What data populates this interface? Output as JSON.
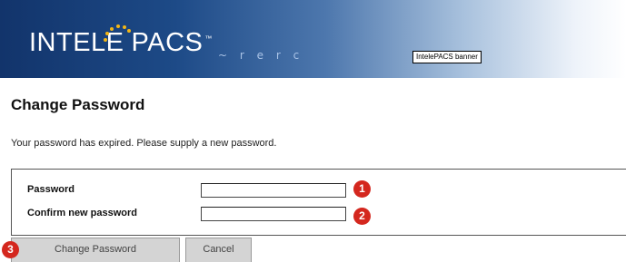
{
  "banner": {
    "logo_left": "INTELE",
    "logo_right": "PACS",
    "trademark": "™",
    "tagline": "~ r e r c",
    "label": "IntelePACS banner"
  },
  "page_title": "Change Password",
  "message": "Your password has expired. Please supply a new password.",
  "form": {
    "password_label": "Password",
    "password_value": "",
    "confirm_label": "Confirm new password",
    "confirm_value": ""
  },
  "callouts": [
    "1",
    "2",
    "3"
  ],
  "buttons": {
    "change_password": "Change Password",
    "cancel": "Cancel"
  },
  "colors": {
    "banner_dark": "#12346b",
    "callout": "#d4271e",
    "logo_dots": "#f2b616"
  }
}
